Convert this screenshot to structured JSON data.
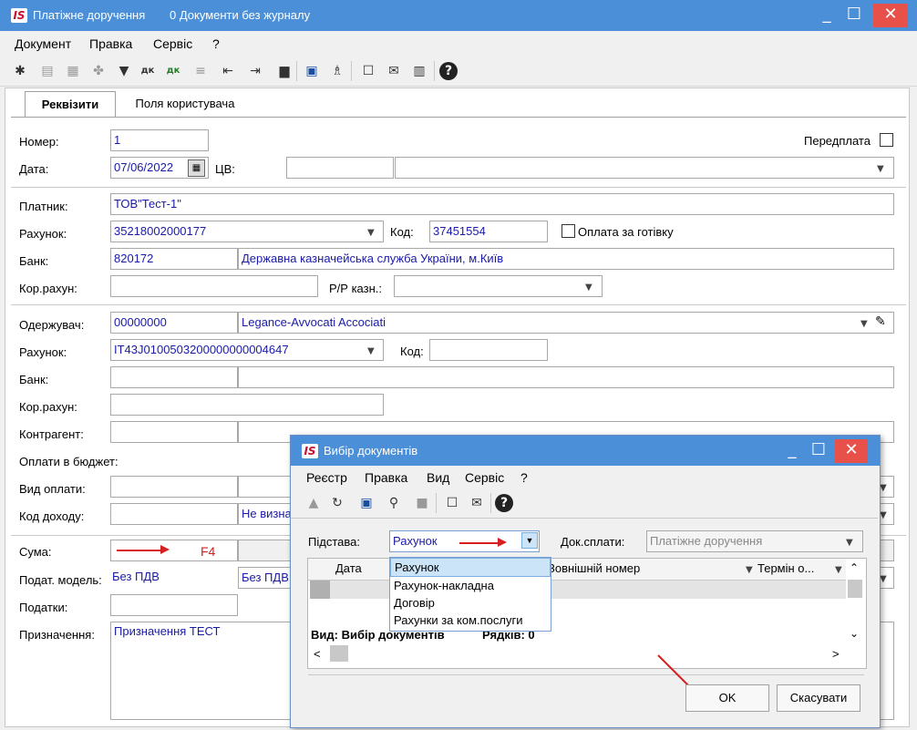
{
  "main_window": {
    "title": "Платіжне доручення",
    "subtitle": "0 Документи без журналу",
    "logo": "IS",
    "controls": {
      "minimize": "_",
      "maximize": "☐",
      "close": "✕"
    }
  },
  "menu": [
    "Документ",
    "Правка",
    "Сервіс",
    "?"
  ],
  "tabs": [
    {
      "label": "Реквізити",
      "active": true
    },
    {
      "label": "Поля користувача",
      "active": false
    }
  ],
  "form": {
    "number_label": "Номер:",
    "number_value": "1",
    "prepayment_label": "Передплата",
    "date_label": "Дата:",
    "date_value": "07/06/2022",
    "cv_label": "ЦВ:",
    "payer_label": "Платник:",
    "payer_value": "ТОВ\"Тест-1\"",
    "account_label": "Рахунок:",
    "account_value": "35218002000177",
    "code_label": "Код:",
    "code_value": "37451554",
    "cash_label": "Оплата за готівку",
    "bank_label": "Банк:",
    "bank_code": "820172",
    "bank_name": "Державна казначейська служба України, м.Київ",
    "corr_label": "Кор.рахун:",
    "rr_label": "Р/Р казн.:",
    "recipient_label": "Одержувач:",
    "recipient_code": "00000000",
    "recipient_name": "Legance-Avvocati Accociati",
    "r_account_label": "Рахунок:",
    "r_account_value": "IT43J0100503200000000004647",
    "r_code_label": "Код:",
    "r_bank_label": "Банк:",
    "r_corr_label": "Кор.рахун:",
    "counterparty_label": "Контрагент:",
    "budget_label": "Оплати в бюджет:",
    "pay_type_label": "Вид оплати:",
    "income_code_label": "Код доходу:",
    "income_code_value": "Не визна",
    "sum_label": "Сума:",
    "sum_hint": "F4",
    "tax_model_label": "Подат. модель:",
    "tax_model_value": "Без ПДВ",
    "tax_model_value2": "Без ПДВ",
    "taxes_label": "Податки:",
    "purpose_label": "Призначення:",
    "purpose_value": "Призначення ТЕСТ"
  },
  "dialog": {
    "title": "Вибір документів",
    "logo": "IS",
    "menu": [
      "Реєстр",
      "Правка",
      "Вид",
      "Сервіс",
      "?"
    ],
    "basis_label": "Підстава:",
    "basis_value": "Рахунок",
    "doc_pay_label": "Док.сплати:",
    "doc_pay_value": "Платіжне доручення",
    "options": [
      "Рахунок",
      "Рахунок-накладна",
      "Договір",
      "Рахунки за ком.послуги"
    ],
    "columns": [
      "Дата",
      "Зовнішній номер",
      "Термін о..."
    ],
    "footer_view": "Вид: Вибір документів",
    "footer_rows": "Рядків: 0",
    "ok_label": "OK",
    "cancel_label": "Скасувати"
  },
  "colors": {
    "titlebar": "#4a8fd8",
    "close": "#e8504a",
    "accent_red": "#d42020",
    "link_blue": "#1a1aa6"
  }
}
